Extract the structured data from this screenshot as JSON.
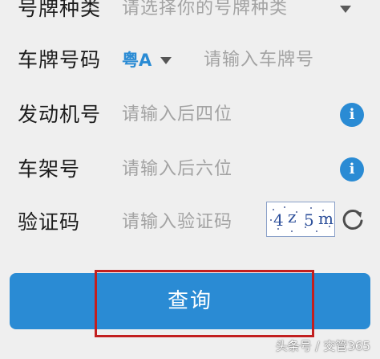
{
  "form": {
    "plate_type": {
      "label": "号牌种类",
      "placeholder": "请选择你的号牌种类"
    },
    "plate_number": {
      "label": "车牌号码",
      "prefix": "粤A",
      "placeholder": "请输入车牌号"
    },
    "engine_number": {
      "label": "发动机号",
      "placeholder": "请输入后四位"
    },
    "frame_number": {
      "label": "车架号",
      "placeholder": "请输入后六位"
    },
    "captcha": {
      "label": "验证码",
      "placeholder": "请输入验证码",
      "chars": [
        "4",
        "z",
        "5",
        "m"
      ]
    }
  },
  "query_button": {
    "label": "查询"
  },
  "watermark": "头条号 / 交管365",
  "colors": {
    "accent": "#2a8bd4",
    "highlight_border": "#c21f1f",
    "background": "#efefef"
  }
}
